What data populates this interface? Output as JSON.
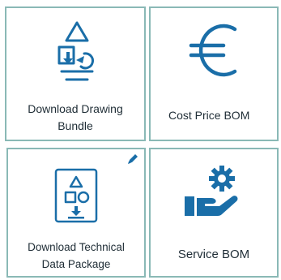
{
  "tiles": [
    {
      "label": "Download Drawing\nBundle",
      "icon": "drawing-bundle-icon"
    },
    {
      "label": "Cost Price BOM",
      "icon": "euro-icon"
    },
    {
      "label": "Download Technical\nData Package",
      "icon": "technical-package-icon"
    },
    {
      "label": "Service BOM",
      "icon": "service-gear-hand-icon"
    }
  ],
  "edit_icon": "pencil-icon",
  "colors": {
    "border": "#8ab9b6",
    "icon_blue": "#1a6ea8",
    "text": "#1f2d36"
  }
}
